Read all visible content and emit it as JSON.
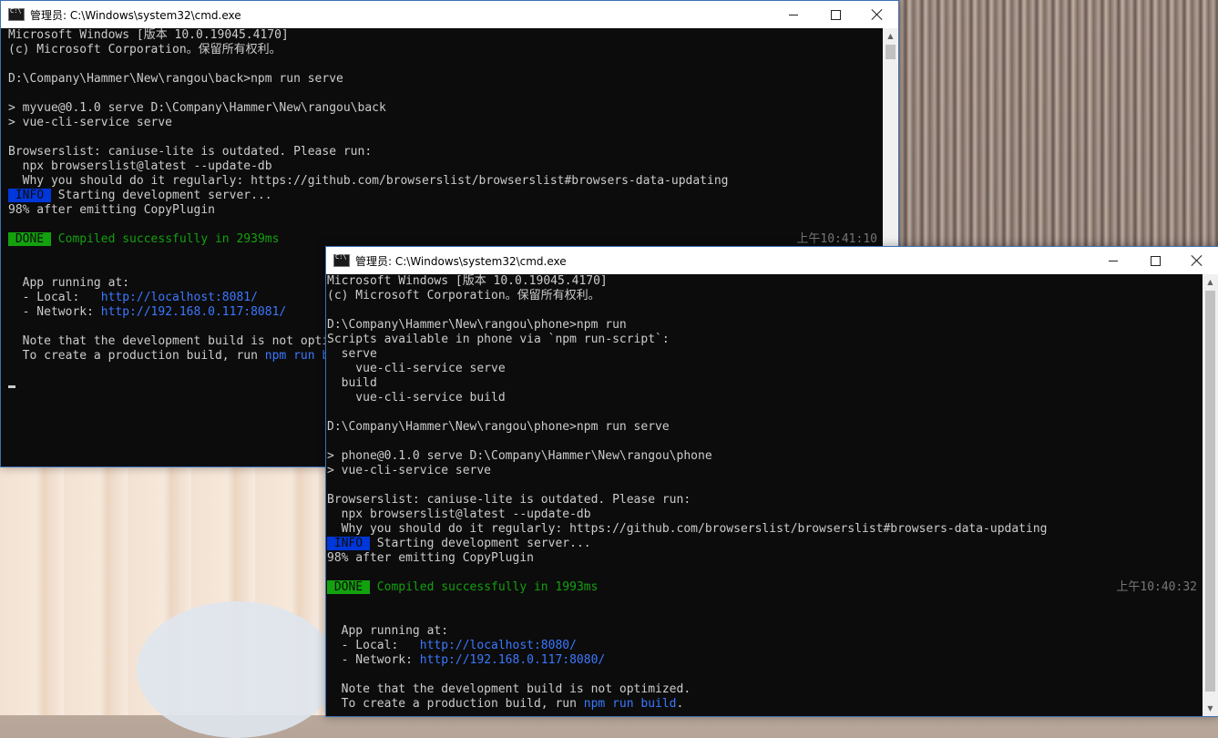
{
  "back_window": {
    "title": "管理员: C:\\Windows\\system32\\cmd.exe",
    "lines": [
      {
        "text": "Microsoft Windows [版本 10.0.19045.4170]"
      },
      {
        "text": "(c) Microsoft Corporation。保留所有权利。"
      },
      {
        "text": ""
      },
      {
        "text": "D:\\Company\\Hammer\\New\\rangou\\back>npm run serve"
      },
      {
        "text": ""
      },
      {
        "text": "> myvue@0.1.0 serve D:\\Company\\Hammer\\New\\rangou\\back"
      },
      {
        "text": "> vue-cli-service serve"
      },
      {
        "text": ""
      },
      {
        "text": "Browserslist: caniuse-lite is outdated. Please run:"
      },
      {
        "text": "  npx browserslist@latest --update-db"
      },
      {
        "text": "  Why you should do it regularly: https://github.com/browserslist/browserslist#browsers-data-updating"
      },
      {
        "tag": " INFO ",
        "tag_style": "info",
        "text": " Starting development server..."
      },
      {
        "text": "98% after emitting CopyPlugin"
      },
      {
        "text": ""
      },
      {
        "tag": " DONE ",
        "tag_style": "done",
        "text": " Compiled successfully in 2939ms",
        "text_style": "green",
        "time": "上午10:41:10"
      },
      {
        "text": ""
      },
      {
        "text": ""
      },
      {
        "text": "  App running at:"
      },
      {
        "text": "  - Local:   ",
        "link": "http://localhost:8081/"
      },
      {
        "text": "  - Network: ",
        "link": "http://192.168.0.117:8081/"
      },
      {
        "text": ""
      },
      {
        "text": "  Note that the development build is not optimized."
      },
      {
        "text": "  To create a production build, run ",
        "link": "npm run build",
        "after": "."
      },
      {
        "text": ""
      },
      {
        "cursor": true
      }
    ]
  },
  "front_window": {
    "title": "管理员: C:\\Windows\\system32\\cmd.exe",
    "lines": [
      {
        "text": "Microsoft Windows [版本 10.0.19045.4170]"
      },
      {
        "text": "(c) Microsoft Corporation。保留所有权利。"
      },
      {
        "text": ""
      },
      {
        "text": "D:\\Company\\Hammer\\New\\rangou\\phone>npm run"
      },
      {
        "text": "Scripts available in phone via `npm run-script`:"
      },
      {
        "text": "  serve"
      },
      {
        "text": "    vue-cli-service serve"
      },
      {
        "text": "  build"
      },
      {
        "text": "    vue-cli-service build"
      },
      {
        "text": ""
      },
      {
        "text": "D:\\Company\\Hammer\\New\\rangou\\phone>npm run serve"
      },
      {
        "text": ""
      },
      {
        "text": "> phone@0.1.0 serve D:\\Company\\Hammer\\New\\rangou\\phone"
      },
      {
        "text": "> vue-cli-service serve"
      },
      {
        "text": ""
      },
      {
        "text": "Browserslist: caniuse-lite is outdated. Please run:"
      },
      {
        "text": "  npx browserslist@latest --update-db"
      },
      {
        "text": "  Why you should do it regularly: https://github.com/browserslist/browserslist#browsers-data-updating"
      },
      {
        "tag": " INFO ",
        "tag_style": "info",
        "text": " Starting development server..."
      },
      {
        "text": "98% after emitting CopyPlugin"
      },
      {
        "text": ""
      },
      {
        "tag": " DONE ",
        "tag_style": "done",
        "text": " Compiled successfully in 1993ms",
        "text_style": "green",
        "time": "上午10:40:32"
      },
      {
        "text": ""
      },
      {
        "text": ""
      },
      {
        "text": "  App running at:"
      },
      {
        "text": "  - Local:   ",
        "link": "http://localhost:8080/"
      },
      {
        "text": "  - Network: ",
        "link": "http://192.168.0.117:8080/"
      },
      {
        "text": ""
      },
      {
        "text": "  Note that the development build is not optimized."
      },
      {
        "text": "  To create a production build, run ",
        "link": "npm run build",
        "after": "."
      }
    ]
  },
  "colors": {
    "console_bg": "#0c0c0c",
    "console_fg": "#cccccc",
    "info_tag": "#0037da",
    "done_tag": "#13a10e",
    "link": "#3b78ff",
    "timestamp": "#767676"
  },
  "icons": {
    "app": "cmd-icon",
    "minimize": "minimize-icon",
    "maximize": "maximize-icon",
    "close": "close-icon"
  }
}
